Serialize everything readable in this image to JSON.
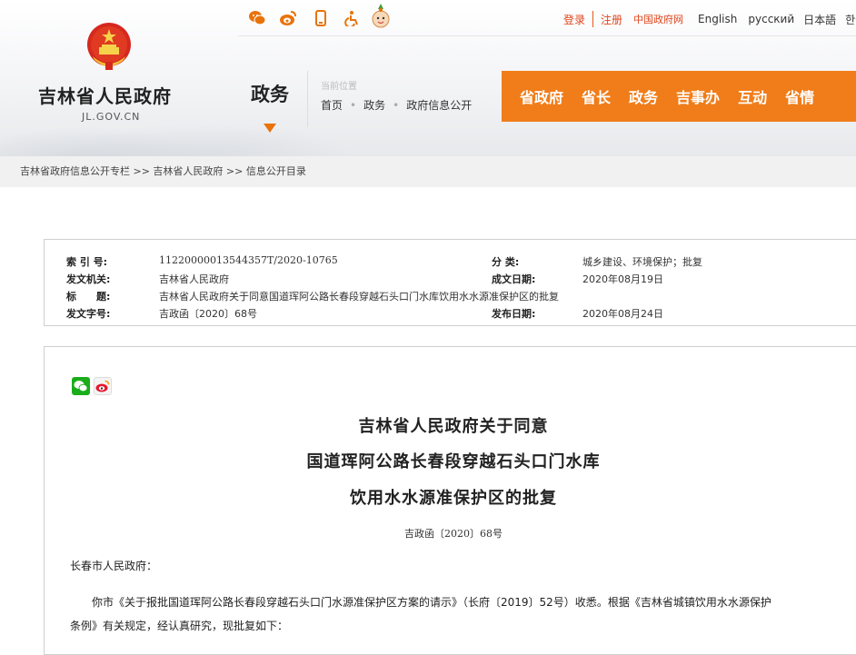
{
  "header": {
    "site_name": "吉林省人民政府",
    "site_domain": "JL.GOV.CN",
    "section_title": "政务",
    "location_label": "当前位置",
    "location_crumbs": [
      "首页",
      "政务",
      "政府信息公开"
    ],
    "top_links": {
      "login": "登录",
      "register": "注册",
      "china_gov": "中国政府网",
      "english": "English",
      "russian": "русский",
      "japanese": "日本語",
      "korean": "한국"
    },
    "top_icons": [
      "wechat-icon",
      "weibo-icon",
      "mobile-icon",
      "accessibility-icon",
      "mascot-icon"
    ],
    "nav": [
      "省政府",
      "省长",
      "政务",
      "吉事办",
      "互动",
      "省情"
    ]
  },
  "breadcrumb": "吉林省政府信息公开专栏 >> 吉林省人民政府 >> 信息公开目录",
  "meta": {
    "index_no_label": "索 引 号:",
    "index_no": "11220000013544357T/2020-10765",
    "category_label": "分 类:",
    "category": "城乡建设、环境保护；批复",
    "issuer_label": "发文机关:",
    "issuer": "吉林省人民政府",
    "written_date_label": "成文日期:",
    "written_date": "2020年08月19日",
    "title_label": "标　　题:",
    "title": "吉林省人民政府关于同意国道珲阿公路长春段穿越石头口门水库饮用水水源准保护区的批复",
    "doc_no_label": "发文字号:",
    "doc_no": "吉政函〔2020〕68号",
    "publish_date_label": "发布日期:",
    "publish_date": "2020年08月24日"
  },
  "document": {
    "title_lines": [
      "吉林省人民政府关于同意",
      "国道珲阿公路长春段穿越石头口门水库",
      "饮用水水源准保护区的批复"
    ],
    "doc_no": "吉政函〔2020〕68号",
    "salutation": "长春市人民政府：",
    "paragraph_1_line_1": "你市《关于报批国道珲阿公路长春段穿越石头口门水源准保护区方案的请示》（长府〔2019〕52号）收悉。根据《吉林省城镇饮用水水源保护",
    "paragraph_1_line_2": "条例》有关规定，经认真研究，现批复如下："
  },
  "colors": {
    "accent_orange": "#f07d1a",
    "link_red": "#e0451b",
    "wechat_green": "#1aad19",
    "weibo_red": "#e6162d"
  }
}
